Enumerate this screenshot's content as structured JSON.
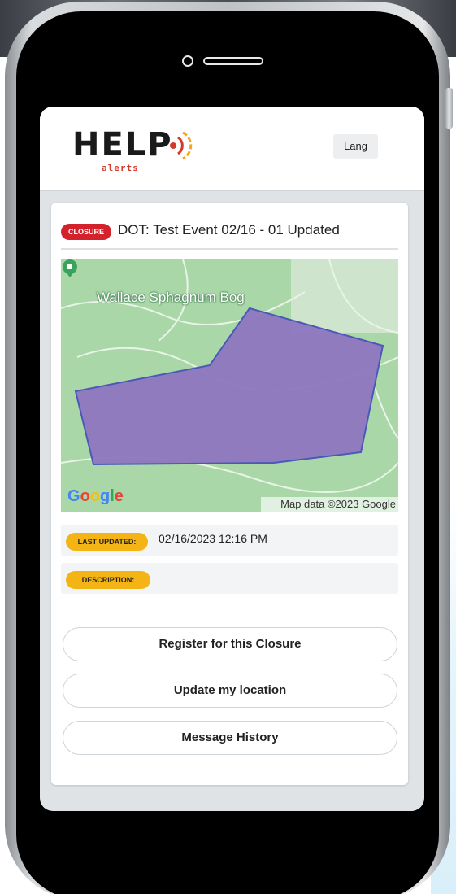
{
  "app": {
    "logo_text": "HELP",
    "logo_sub": "alerts",
    "lang_label": "Lang"
  },
  "event": {
    "badge": "CLOSURE",
    "title": "DOT: Test Event 02/16 - 01 Updated"
  },
  "map": {
    "place_label": "Wallace Sphagnum Bog",
    "provider_logo": "Google",
    "credit": "Map data ©2023 Google",
    "polygon_color": "#8e76c0",
    "polygon_stroke": "#4a59b8"
  },
  "details": {
    "last_updated_label": "LAST UPDATED:",
    "last_updated_value": "02/16/2023 12:16 PM",
    "description_label": "DESCRIPTION:",
    "description_value": ""
  },
  "actions": {
    "register_label": "Register for this Closure",
    "update_location_label": "Update my location",
    "message_history_label": "Message History"
  },
  "colors": {
    "badge_red": "#d3222c",
    "pill_yellow": "#f5b416"
  }
}
